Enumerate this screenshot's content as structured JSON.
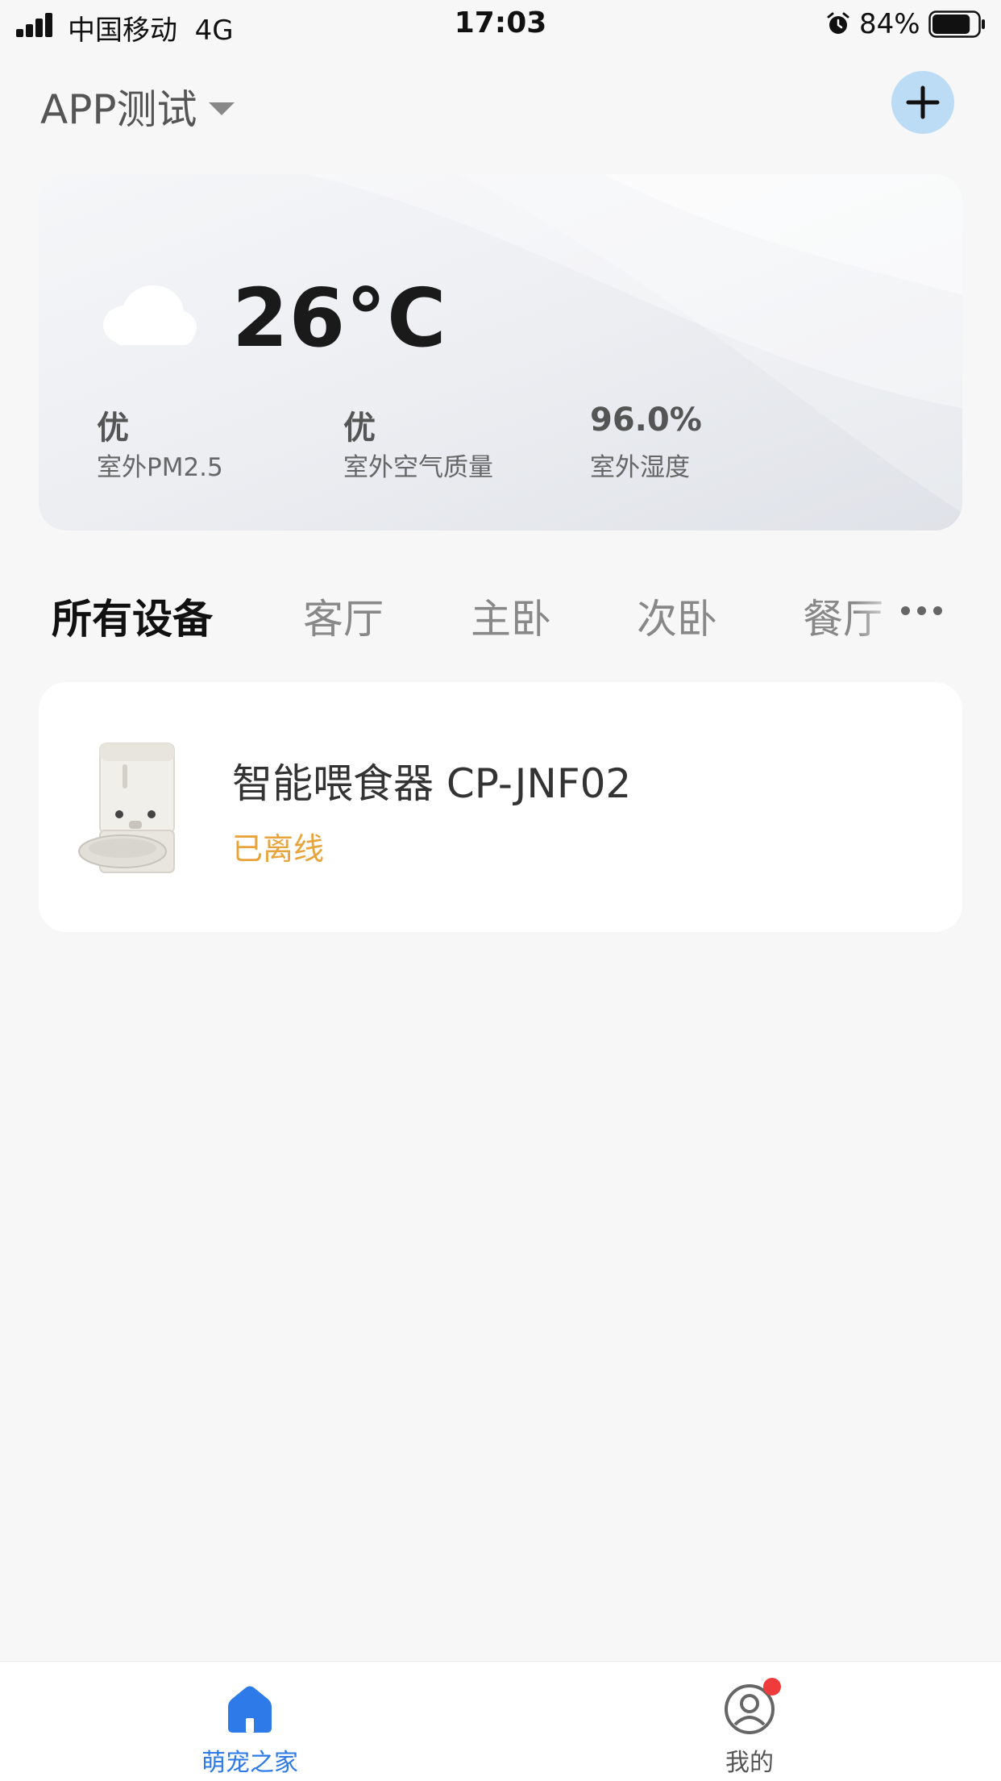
{
  "status_bar": {
    "carrier": "中国移动",
    "network": "4G",
    "time": "17:03",
    "battery": "84%",
    "battery_level": 0.84
  },
  "header": {
    "home_name": "APP测试",
    "add_icon": "plus-icon"
  },
  "weather": {
    "icon": "cloud-icon",
    "temperature": "26°C",
    "stats": [
      {
        "value": "优",
        "label": "室外PM2.5"
      },
      {
        "value": "优",
        "label": "室外空气质量"
      },
      {
        "value": "96.0%",
        "label": "室外湿度"
      }
    ]
  },
  "room_tabs": {
    "items": [
      "所有设备",
      "客厅",
      "主卧",
      "次卧",
      "餐厅"
    ],
    "active_index": 0,
    "more_icon": "more-dots-icon"
  },
  "devices": [
    {
      "name": "智能喂食器 CP-JNF02",
      "status": "已离线",
      "status_color": "#e8a33a"
    }
  ],
  "bottom_nav": {
    "items": [
      {
        "label": "萌宠之家",
        "icon": "home-icon",
        "active": true
      },
      {
        "label": "我的",
        "icon": "profile-icon",
        "active": false,
        "badge": true
      }
    ],
    "accent_color": "#2d7ae8"
  }
}
